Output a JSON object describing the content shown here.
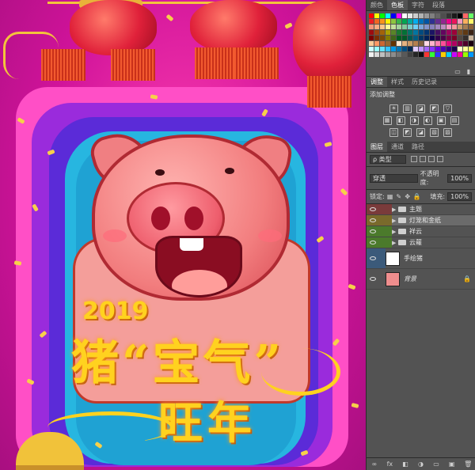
{
  "swatches_panel": {
    "tabs": [
      "颜色",
      "色板",
      "字符",
      "段落"
    ],
    "active_tab": 1,
    "colors": [
      "#ff0000",
      "#ffff00",
      "#00ff00",
      "#00ffff",
      "#0000ff",
      "#ff00ff",
      "#ffffff",
      "#e6e6e6",
      "#cccccc",
      "#b3b3b3",
      "#999999",
      "#808080",
      "#666666",
      "#4d4d4d",
      "#333333",
      "#1a1a1a",
      "#000000",
      "#ff6666",
      "#66ff66",
      "#ee1d24",
      "#f26522",
      "#f7941d",
      "#fff200",
      "#8dc63f",
      "#39b54a",
      "#00a651",
      "#00a99d",
      "#00aeef",
      "#0072bc",
      "#0054a6",
      "#2e3192",
      "#662d91",
      "#92278f",
      "#ec008c",
      "#ed145b",
      "#f49ac1",
      "#fbaf5d",
      "#fff568",
      "#f69679",
      "#f9ad81",
      "#fdc689",
      "#fff79a",
      "#c4df9b",
      "#a3d39c",
      "#82ca9c",
      "#7accc8",
      "#6dcff6",
      "#7da7d9",
      "#8393ca",
      "#8781bd",
      "#a187be",
      "#bd8cbf",
      "#f49ac2",
      "#f6989d",
      "#c69c6d",
      "#a67c52",
      "#8c6239",
      "#9e0b0f",
      "#a0410d",
      "#a36209",
      "#aba000",
      "#598527",
      "#1a7b30",
      "#007236",
      "#00746b",
      "#0076a3",
      "#004b80",
      "#003471",
      "#1b1464",
      "#440e62",
      "#630460",
      "#9e005d",
      "#9e0039",
      "#754c24",
      "#603913",
      "#3c2415",
      "#790000",
      "#7b2e00",
      "#7d4900",
      "#827b00",
      "#406618",
      "#005e20",
      "#005826",
      "#005952",
      "#005b7f",
      "#003663",
      "#002157",
      "#0d004c",
      "#32004b",
      "#4b0049",
      "#7b0046",
      "#7a0026",
      "#534741",
      "#362f2d",
      "#c7b299",
      "#ffcc99",
      "#ff9966",
      "#cc6633",
      "#996633",
      "#663300",
      "#ffe5cc",
      "#e5b280",
      "#cc9966",
      "#b37f4d",
      "#806040",
      "#ffd9e6",
      "#ffb3cc",
      "#ff80b3",
      "#ff4d99",
      "#e6007e",
      "#b30062",
      "#800046",
      "#4d002a",
      "#1a000e",
      "#ccffff",
      "#99ffff",
      "#66e0ff",
      "#33c2ff",
      "#0099e6",
      "#0073b3",
      "#004d80",
      "#00264d",
      "#e0ccff",
      "#c299ff",
      "#a366ff",
      "#8533ff",
      "#6600e6",
      "#4d00b3",
      "#330080",
      "#1a004d",
      "#ffffcc",
      "#ffff99",
      "#ffff66",
      "#f2f2f2",
      "#d9d9d9",
      "#bfbfbf",
      "#a6a6a6",
      "#8c8c8c",
      "#737373",
      "#595959",
      "#404040",
      "#262626",
      "#0d0d0d",
      "#ff3333",
      "#33ff33",
      "#3333ff",
      "#ffcc00",
      "#00ccff",
      "#cc00ff",
      "#ff0099",
      "#99ff00",
      "#0099ff"
    ]
  },
  "adjustments_panel": {
    "tabs": [
      "调整",
      "样式",
      "历史记录"
    ],
    "active_tab": 0,
    "title": "添加调整",
    "row1": [
      "☀",
      "▥",
      "◪",
      "◩",
      "▽"
    ],
    "row2": [
      "▦",
      "◧",
      "◑",
      "◐",
      "▣",
      "▤"
    ],
    "row3": [
      "◫",
      "◩",
      "◪",
      "▧",
      "▨"
    ]
  },
  "layers_panel": {
    "tabs": [
      "图层",
      "通道",
      "路径"
    ],
    "active_tab": 0,
    "filter_label": "ρ 类型",
    "blend_mode": "穿透",
    "opacity_label": "不透明度:",
    "opacity_value": "100%",
    "lock_label": "锁定:",
    "fill_label": "填充:",
    "fill_value": "100%",
    "layers": [
      {
        "name": "主题",
        "type": "group",
        "color": "#7a3b3b",
        "selected": false
      },
      {
        "name": "灯笼和金纸",
        "type": "group",
        "color": "#7a6a2b",
        "selected": true
      },
      {
        "name": "祥云",
        "type": "group",
        "color": "#4b7a2b",
        "selected": false
      },
      {
        "name": "云蘿",
        "type": "group",
        "color": "#4b7a2b",
        "selected": false
      },
      {
        "name": "手绘猪",
        "type": "layer",
        "color": "#3b5a7a",
        "selected": false
      },
      {
        "name": "背景",
        "type": "background",
        "color": "",
        "selected": false
      }
    ],
    "footer_icons": [
      "∞",
      "fx",
      "◧",
      "◑",
      "▭",
      "▣",
      "🗑"
    ]
  },
  "artwork": {
    "year": "2019",
    "slogan_line1": "猪“宝气”",
    "slogan_line2": "旺年"
  }
}
